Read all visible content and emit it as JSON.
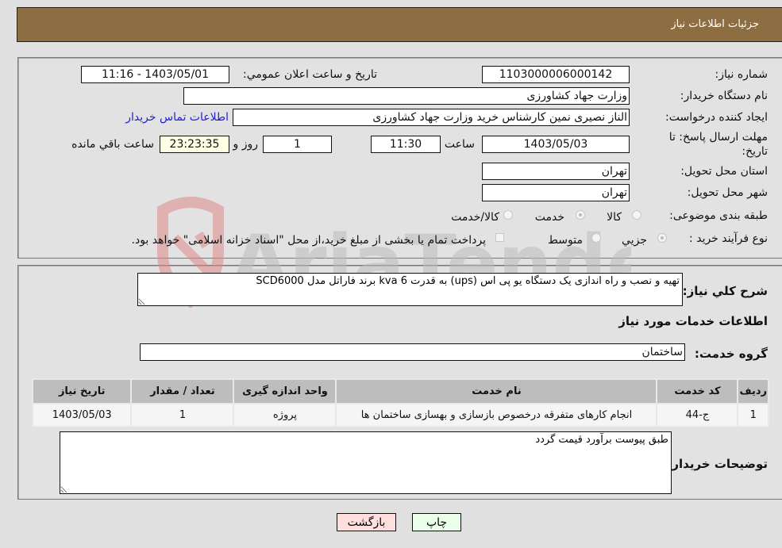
{
  "header": {
    "title": "جزئیات اطلاعات نیاز"
  },
  "form": {
    "need_number_label": "شماره نیاز:",
    "need_number": "1103000006000142",
    "announce_label": "تاریخ و ساعت اعلان عمومي:",
    "announce_value": "1403/05/01 - 11:16",
    "buyer_org_label": "نام دستگاه خریدار:",
    "buyer_org": "وزارت جهاد کشاورزی",
    "creator_label": "ایجاد کننده درخواست:",
    "creator": "الناز نصیری نمین کارشناس خرید وزارت جهاد کشاورزی",
    "contact_link": "اطلاعات تماس خریدار",
    "deadline_label": "مهلت ارسال پاسخ: تا تاریخ:",
    "deadline_date": "1403/05/03",
    "time_label": "ساعت",
    "deadline_time": "11:30",
    "days_value": "1",
    "days_label": "روز و",
    "remaining_time": "23:23:35",
    "remaining_label": "ساعت باقي مانده",
    "province_label": "استان محل تحویل:",
    "province": "تهران",
    "city_label": "شهر محل تحویل:",
    "city": "تهران",
    "category_label": "طبقه بندی موضوعی:",
    "category_options": [
      "کالا",
      "خدمت",
      "کالا/خدمت"
    ],
    "category_selected": "خدمت",
    "process_label": "نوع فرآیند خرید :",
    "process_options": [
      "جزيي",
      "متوسط"
    ],
    "process_selected": "جزيي",
    "treasury_note": "پرداخت تمام یا بخشی از مبلغ خرید،از محل \"اسناد خزانه اسلامی\" خواهد بود."
  },
  "details": {
    "description_label": "شرح کلي نیاز:",
    "description": "تهیه و نصب و راه اندازی یک دستگاه یو پی اس (ups) به قدرت 6 kva برند فاراتل مدل SCD6000",
    "services_title": "اطلاعات خدمات مورد نیاز",
    "service_group_label": "گروه خدمت:",
    "service_group": "ساختمان",
    "table": {
      "headers": [
        "ردیف",
        "کد خدمت",
        "نام خدمت",
        "واحد اندازه گیری",
        "تعداد / مقدار",
        "تاریخ نیاز"
      ],
      "rows": [
        [
          "1",
          "ج-44",
          "انجام کارهای متفرقه درخصوص بازسازی و بهسازی ساختمان ها",
          "پروژه",
          "1",
          "1403/05/03"
        ]
      ]
    },
    "buyer_notes_label": "توضیحات خریدار:",
    "buyer_notes": "طبق پیوست برآورد قیمت گردد"
  },
  "buttons": {
    "print": "چاپ",
    "back": "بازگشت"
  },
  "watermark": {
    "text": "AriaTender.neT"
  },
  "colors": {
    "header_bg": "#8d6e43",
    "back_btn_bg": "#ffdede",
    "print_btn_bg": "#eaffea",
    "link": "#2222cc"
  }
}
